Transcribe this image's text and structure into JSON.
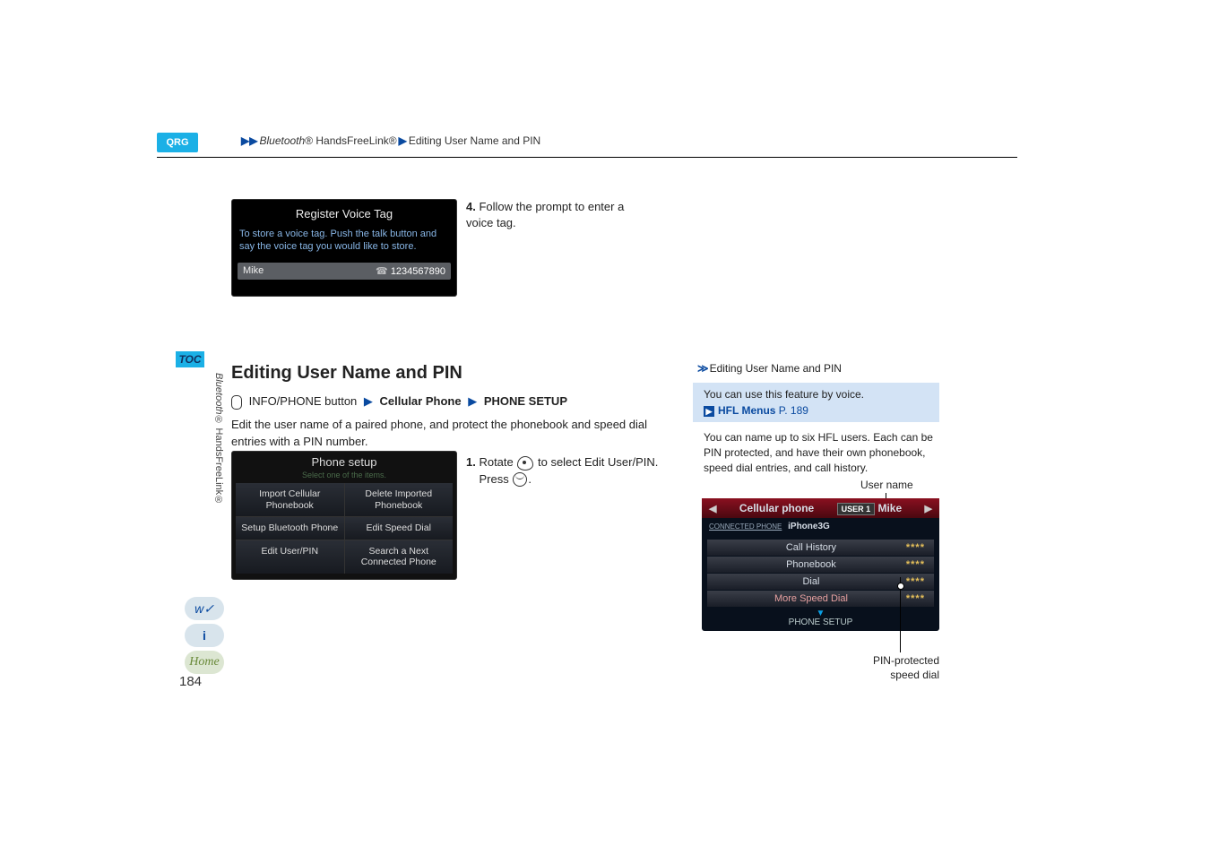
{
  "breadcrumb": {
    "part1": "Bluetooth",
    "reg": "®",
    "part2": " HandsFreeLink®",
    "part3": "Editing User Name and PIN"
  },
  "qrg": "QRG",
  "toc": "TOC",
  "side": {
    "bt": "Bluetooth",
    "reg": "®",
    "hfl": " HandsFreeLink®"
  },
  "page_num": "184",
  "screenshot1": {
    "title": "Register Voice Tag",
    "text": "To store a voice tag. Push the talk button and say the voice tag you would like to store.",
    "name": "Mike",
    "number": "1234567890"
  },
  "step4": {
    "num": "4.",
    "text": " Follow the prompt to enter a voice tag."
  },
  "heading": "Editing User Name and PIN",
  "nav": {
    "btn": "INFO/PHONE button",
    "a": "Cellular Phone",
    "b": "PHONE SETUP"
  },
  "body": "Edit the user name of a paired phone, and protect the phonebook and speed dial entries with a PIN number.",
  "phone_setup": {
    "title": "Phone setup",
    "sub": "Select one of the items.",
    "cells": [
      "Import Cellular Phonebook",
      "Delete Imported Phonebook",
      "Setup Bluetooth Phone",
      "Edit Speed Dial",
      "Edit User/PIN",
      "Search a Next Connected Phone"
    ]
  },
  "step1": {
    "num": "1.",
    "rotate": " Rotate ",
    "txt_select": " to select ",
    "target": "Edit User/PIN",
    "period": ". ",
    "press": "Press ",
    "period2": "."
  },
  "right": {
    "head": "Editing User Name and PIN",
    "voice": "You can use this feature by voice.",
    "link_label": "HFL Menus",
    "link_page": " P. 189",
    "para": "You can name up to six HFL users. Each can be PIN protected, and have their own phonebook, speed dial entries, and call history.",
    "label_user": "User name",
    "label_pin": "PIN-protected speed dial"
  },
  "cell_screen": {
    "title": "Cellular phone",
    "user_badge": "USER 1",
    "user_name": "Mike",
    "conn_label": "CONNECTED PHONE",
    "conn_value": "iPhone3G",
    "rows": [
      {
        "name": "Call History",
        "stars": "****"
      },
      {
        "name": "Phonebook",
        "stars": "****"
      },
      {
        "name": "Dial",
        "stars": "****"
      },
      {
        "name": "More Speed Dial",
        "stars": "****"
      }
    ],
    "footer": "PHONE SETUP"
  },
  "icons": {
    "voice": "w✓",
    "info": "i",
    "home": "Home"
  }
}
